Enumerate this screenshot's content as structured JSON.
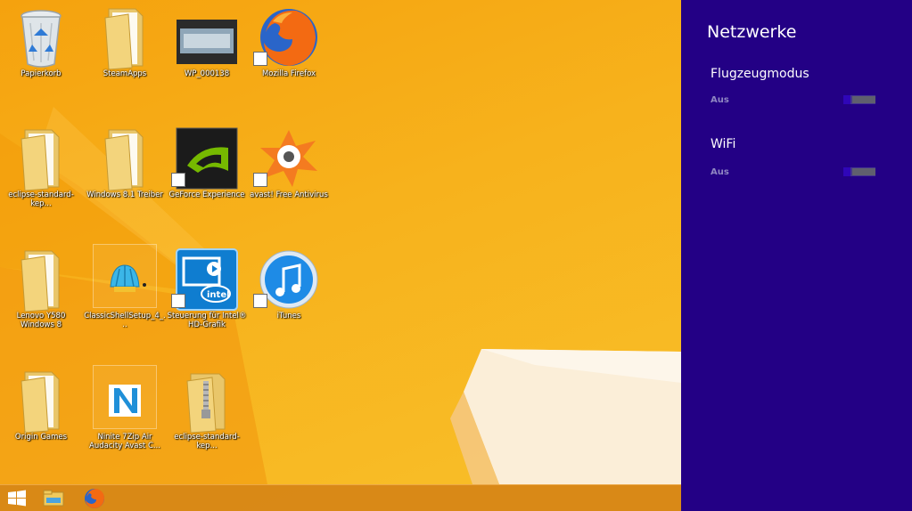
{
  "desktop": {
    "icons": [
      {
        "label": "Papierkorb",
        "icon": "recycle-bin-icon"
      },
      {
        "label": "SteamApps",
        "icon": "folder-icon"
      },
      {
        "label": "WP_000138",
        "icon": "photo-thumbnail-icon"
      },
      {
        "label": "Mozilla Firefox",
        "icon": "firefox-icon"
      },
      {
        "label": "eclipse-standard-kep...",
        "icon": "folder-icon"
      },
      {
        "label": "Windows 8.1 Treiber",
        "icon": "folder-icon"
      },
      {
        "label": "GeForce Experience",
        "icon": "nvidia-icon"
      },
      {
        "label": "avast! Free Antivirus",
        "icon": "avast-icon"
      },
      {
        "label": "Lenovo Y580 Windows 8",
        "icon": "folder-icon"
      },
      {
        "label": "ClassicShellSetup_4_...",
        "icon": "classic-shell-icon"
      },
      {
        "label": "Steuerung für Intel® HD-Grafik",
        "icon": "intel-hd-graphics-icon"
      },
      {
        "label": "iTunes",
        "icon": "itunes-icon"
      },
      {
        "label": "Origin Games",
        "icon": "folder-icon"
      },
      {
        "label": "Ninite 7Zip Air Audacity Avast C...",
        "icon": "ninite-icon"
      },
      {
        "label": "eclipse-standard-kep...",
        "icon": "zip-folder-icon"
      }
    ]
  },
  "taskbar": {
    "items": [
      {
        "icon": "windows-start-icon"
      },
      {
        "icon": "file-explorer-icon"
      },
      {
        "icon": "firefox-icon"
      }
    ]
  },
  "charm": {
    "title": "Netzwerke",
    "networks": [
      {
        "name": "Flugzeugmodus",
        "state": "Aus"
      },
      {
        "name": "WiFi",
        "state": "Aus"
      }
    ]
  },
  "colors": {
    "charm_bg": "#230085",
    "desktop_bg": "#f5a20e",
    "state_text": "#8f86c2"
  }
}
